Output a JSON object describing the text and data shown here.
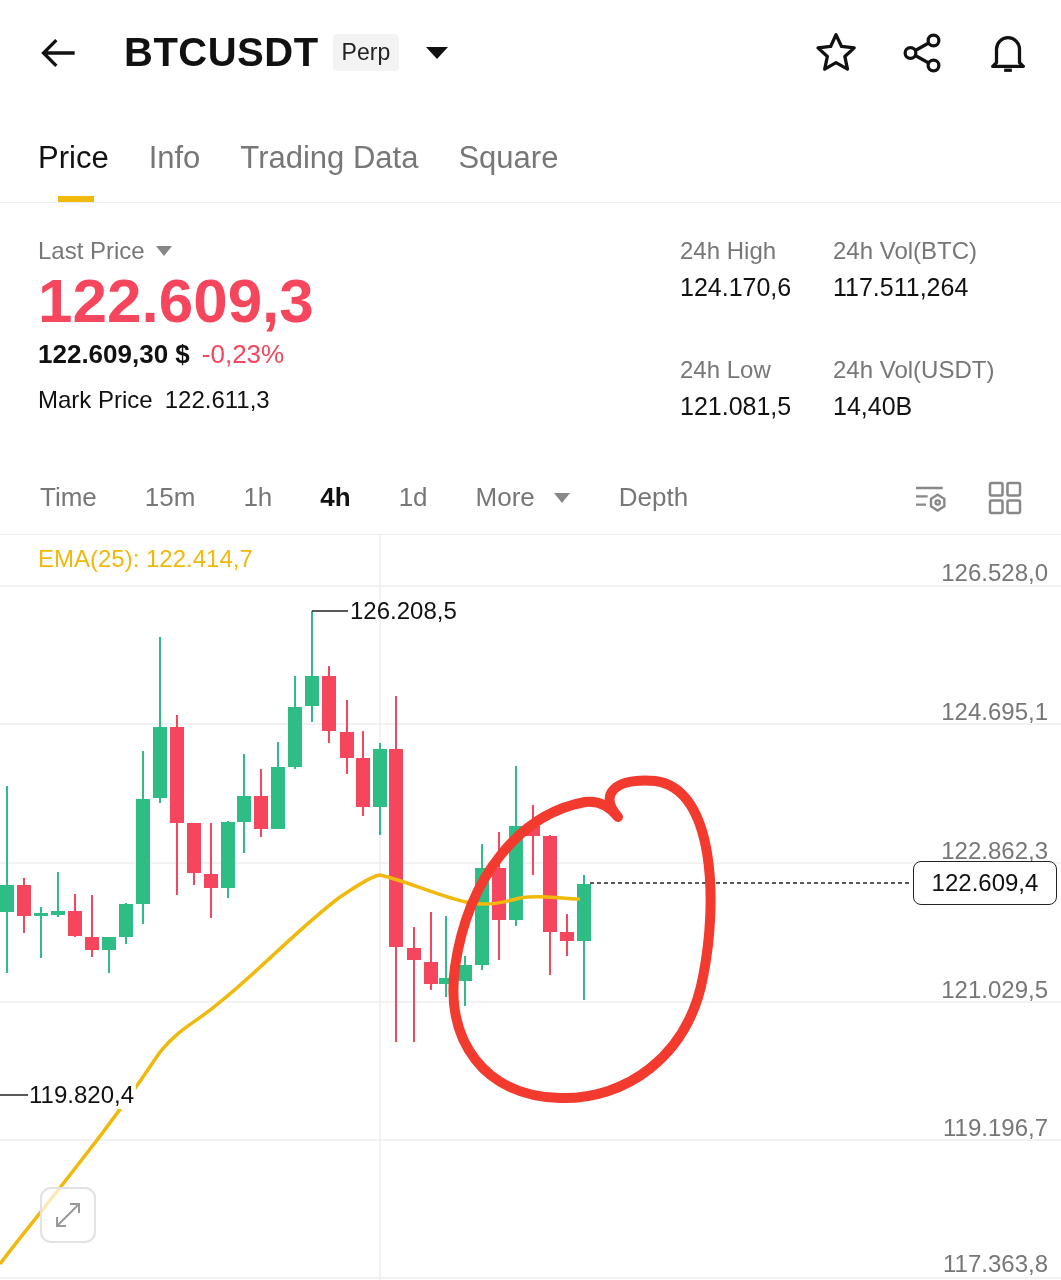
{
  "header": {
    "symbol": "BTCUSDT",
    "badge": "Perp"
  },
  "tabs": [
    {
      "label": "Price",
      "selected": true
    },
    {
      "label": "Info",
      "selected": false
    },
    {
      "label": "Trading Data",
      "selected": false
    },
    {
      "label": "Square",
      "selected": false
    }
  ],
  "ticker": {
    "last_price_label": "Last Price",
    "last_price": "122.609,3",
    "down": true,
    "fiat_price": "122.609,30 $",
    "change": "-0,23%",
    "mark_price_label": "Mark Price",
    "mark_price": "122.611,3",
    "stats": [
      {
        "label": "24h High",
        "value": "124.170,6"
      },
      {
        "label": "24h Vol(BTC)",
        "value": "117.511,264"
      },
      {
        "label": "24h Low",
        "value": "121.081,5"
      },
      {
        "label": "24h Vol(USDT)",
        "value": "14,40B"
      }
    ]
  },
  "intervals": [
    {
      "label": "Time",
      "kind": "plain",
      "selected": false
    },
    {
      "label": "15m",
      "kind": "plain",
      "selected": false
    },
    {
      "label": "1h",
      "kind": "plain",
      "selected": false
    },
    {
      "label": "4h",
      "kind": "plain",
      "selected": true
    },
    {
      "label": "1d",
      "kind": "plain",
      "selected": false
    },
    {
      "label": "More",
      "kind": "dropdown",
      "selected": false
    },
    {
      "label": "Depth",
      "kind": "plain",
      "selected": false
    }
  ],
  "chart": {
    "indicator": "EMA(25): 122.414,7",
    "price_axis": [
      "126.528,0",
      "124.695,1",
      "122.862,3",
      "121.029,5",
      "119.196,7",
      "117.363,8"
    ],
    "high_marker": "126.208,5",
    "low_marker": "119.820,4",
    "current_price": "122.609,4"
  }
}
